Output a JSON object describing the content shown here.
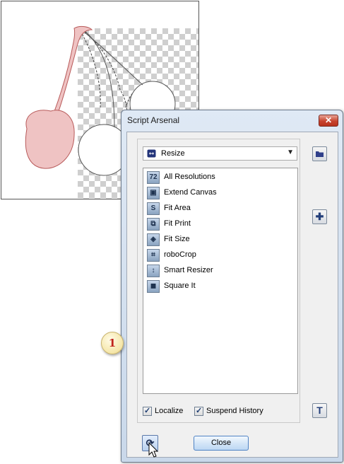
{
  "dialog": {
    "title": "Script Arsenal",
    "close_glyph": "✕",
    "category_selected": "Resize",
    "category_icon": "resize-arrows-icon",
    "scripts": [
      {
        "label": "All Resolutions",
        "icon_text": "72",
        "icon": "resolution-icon"
      },
      {
        "label": "Extend Canvas",
        "icon_text": "▣",
        "icon": "extend-canvas-icon"
      },
      {
        "label": "Fit Area",
        "icon_text": "S",
        "icon": "fit-area-icon"
      },
      {
        "label": "Fit Print",
        "icon_text": "⧉",
        "icon": "fit-print-icon"
      },
      {
        "label": "Fit Size",
        "icon_text": "◈",
        "icon": "fit-size-icon"
      },
      {
        "label": "roboCrop",
        "icon_text": "⌗",
        "icon": "crop-icon"
      },
      {
        "label": "Smart Resizer",
        "icon_text": "↕",
        "icon": "smart-resizer-icon"
      },
      {
        "label": "Square It",
        "icon_text": "◼",
        "icon": "square-it-icon"
      }
    ],
    "localize_label": "Localize",
    "localize_checked": true,
    "suspend_history_label": "Suspend History",
    "suspend_history_checked": true,
    "close_button_label": "Close",
    "folder_glyph": "▬",
    "add_glyph": "✚",
    "tool_glyph": "T",
    "refresh_glyph": "⟳"
  },
  "callout_number": "1",
  "colors": {
    "cherry_fill": "#efc3c3",
    "cherry_outline": "#c56a6a",
    "accent_red": "#c0231b"
  }
}
